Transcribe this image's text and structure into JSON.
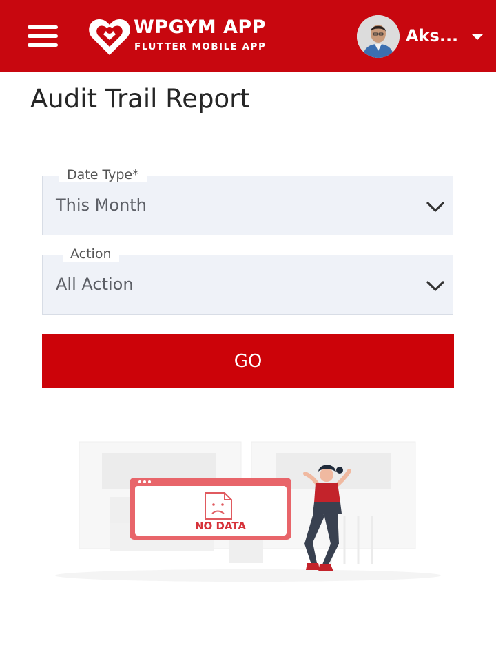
{
  "header": {
    "logo_title": "WPGYM APP",
    "logo_subtitle": "FLUTTER MOBILE APP",
    "user_name": "Aks...",
    "menu_icon": "hamburger-menu-icon",
    "dropdown_icon": "caret-down-icon",
    "background_color": "#c8070f"
  },
  "page": {
    "title": "Audit Trail Report"
  },
  "form": {
    "date_type": {
      "label": "Date Type*",
      "value": "This Month",
      "icon": "chevron-down-icon"
    },
    "action": {
      "label": "Action",
      "value": "All Action",
      "icon": "chevron-down-icon"
    },
    "go_label": "GO",
    "button_color": "#cc0309"
  },
  "empty_state": {
    "text": "NO DATA",
    "accent_color": "#e05a5f"
  }
}
